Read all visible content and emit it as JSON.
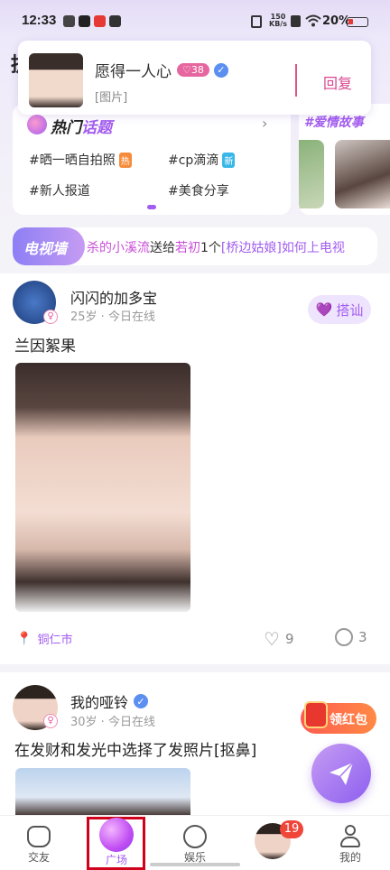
{
  "status_bar": {
    "time": "12:33",
    "net_speed_value": "150",
    "net_speed_unit": "KB/s",
    "battery": "20%"
  },
  "notification": {
    "name": "愿得一人心",
    "badge": "38",
    "message": "[图片]",
    "reply_label": "回复"
  },
  "header": {
    "partial_char": "提"
  },
  "topics": {
    "title_part1": "热门",
    "title_part2": "话题",
    "items": [
      {
        "text": "#晒一晒自拍照",
        "tag": "热",
        "tag_color": "#f58b3b"
      },
      {
        "text": "#cp滴滴",
        "tag": "新",
        "tag_color": "#39b7e8"
      },
      {
        "text": "#新人报道",
        "tag": "",
        "tag_color": ""
      },
      {
        "text": "#美食分享",
        "tag": "",
        "tag_color": ""
      }
    ]
  },
  "story": {
    "title": "#爱情故事"
  },
  "tv_wall": {
    "label": "电视墙",
    "marquee_part1": "杀的",
    "marquee_name1": "小溪流",
    "marquee_part2": "送给",
    "marquee_name2": "若初",
    "marquee_part3": "1个",
    "marquee_gift": "[桥边姑娘]",
    "marquee_part4": "如何上电视"
  },
  "post1": {
    "name": "闪闪的加多宝",
    "meta": "25岁 · 今日在线",
    "chat_label": "搭讪",
    "text": "兰因絮果",
    "location": "铜仁市",
    "likes": "9",
    "comments": "3"
  },
  "post2": {
    "name": "我的哑铃",
    "meta": "30岁 · 今日在线",
    "text": "在发财和发光中选择了发照片[抠鼻]",
    "red_packet_label": "领红包"
  },
  "bottom_nav": {
    "items": [
      {
        "label": "交友"
      },
      {
        "label": "广场"
      },
      {
        "label": "娱乐"
      },
      {
        "label": "",
        "badge": "19"
      },
      {
        "label": "我的"
      }
    ]
  },
  "colors": {
    "accent_purple": "#a35cf0",
    "accent_pink": "#e5559c",
    "reply_pink": "#d9468f",
    "highlight_red": "#d0021b"
  }
}
